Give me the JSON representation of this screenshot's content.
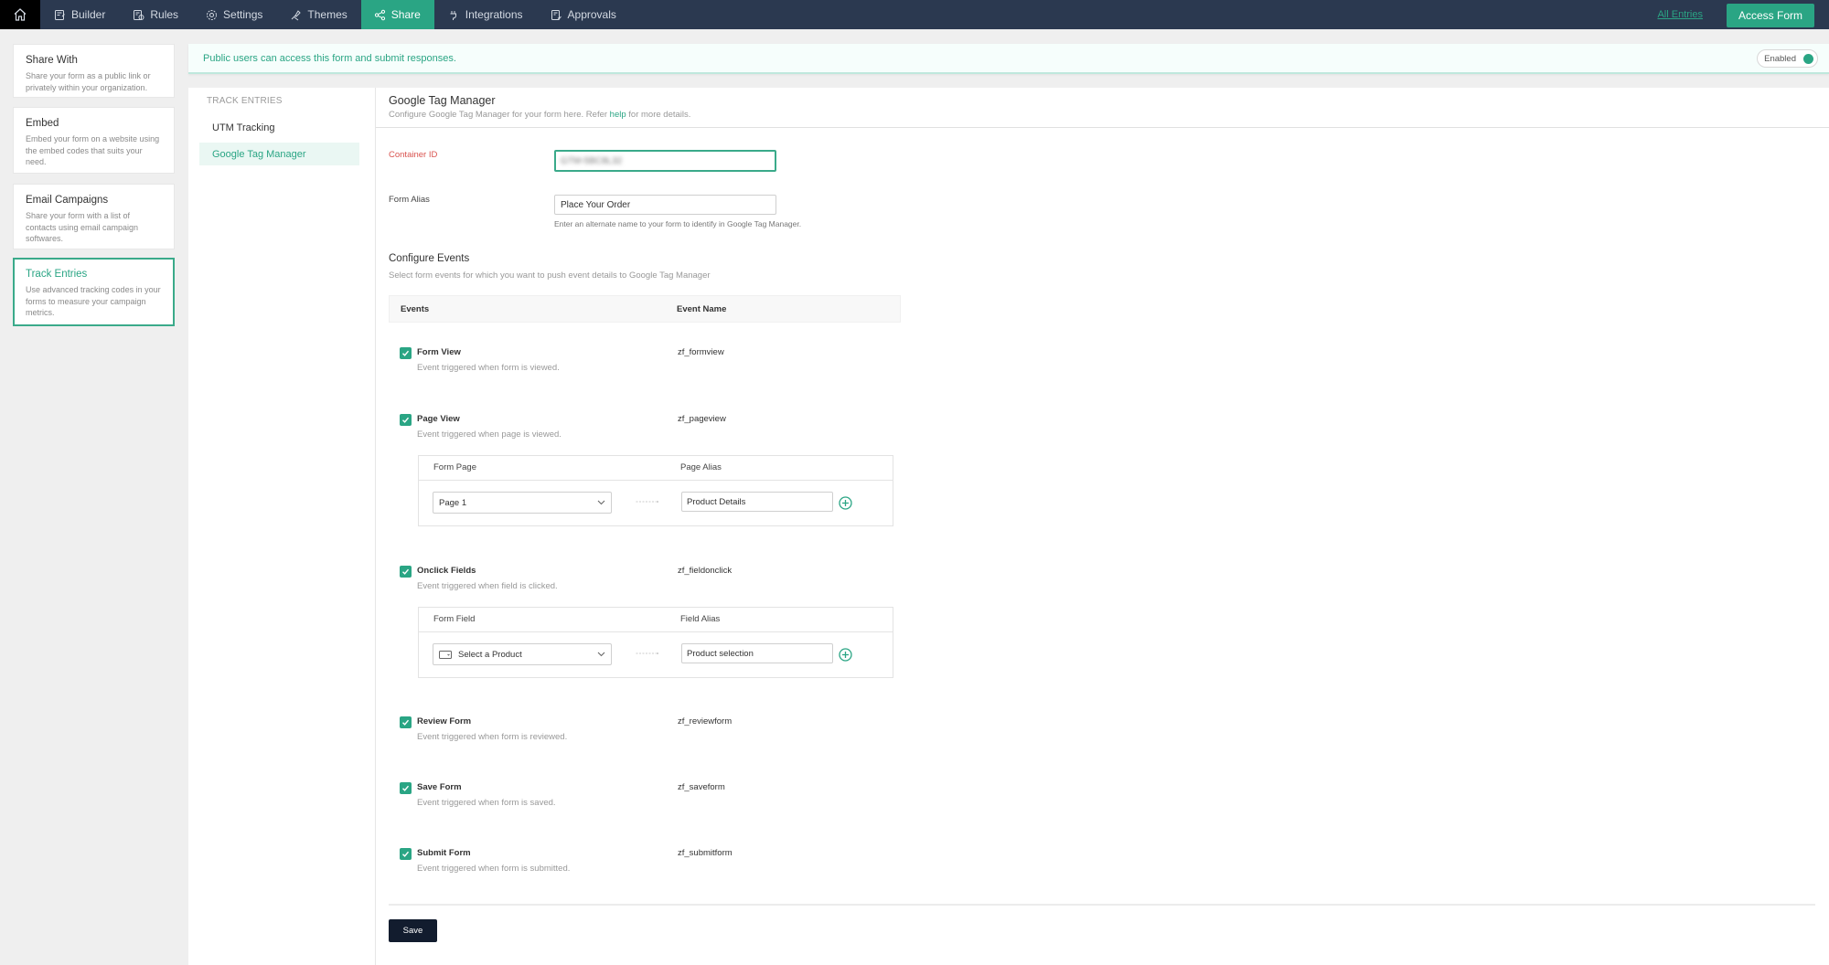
{
  "topnav": {
    "items": [
      {
        "label": "Builder",
        "icon": "builder-icon"
      },
      {
        "label": "Rules",
        "icon": "rules-icon"
      },
      {
        "label": "Settings",
        "icon": "gear-icon"
      },
      {
        "label": "Themes",
        "icon": "themes-brush-icon"
      },
      {
        "label": "Share",
        "icon": "share-icon",
        "active": true
      },
      {
        "label": "Integrations",
        "icon": "integrations-plug-icon"
      },
      {
        "label": "Approvals",
        "icon": "approvals-icon"
      }
    ],
    "all_entries_label": "All Entries",
    "access_form_label": "Access Form"
  },
  "share_options": [
    {
      "title": "Share With",
      "desc": "Share your form as a public link or privately within your organization."
    },
    {
      "title": "Embed",
      "desc": "Embed your form on a website using the embed codes that suits your need."
    },
    {
      "title": "Email Campaigns",
      "desc": "Share your form with a list of contacts using email campaign softwares."
    },
    {
      "title": "Track Entries",
      "desc": "Use advanced tracking codes in your forms to measure your campaign metrics.",
      "active": true
    }
  ],
  "banner": {
    "text": "Public users can access this form and submit responses.",
    "toggle_label": "Enabled",
    "toggle_on": true
  },
  "subnav": {
    "heading": "TRACK ENTRIES",
    "items": [
      {
        "label": "UTM Tracking"
      },
      {
        "label": "Google Tag Manager",
        "active": true
      }
    ]
  },
  "gtm": {
    "title": "Google Tag Manager",
    "subtitle_pre": "Configure Google Tag Manager for your form here. Refer ",
    "subtitle_link": "help",
    "subtitle_post": " for more details.",
    "container_id_label": "Container ID",
    "container_id_value": "GTM-5BC8L32",
    "form_alias_label": "Form Alias",
    "form_alias_value": "Place Your Order",
    "form_alias_hint": "Enter an alternate name to your form to identify in Google Tag Manager.",
    "configure_title": "Configure Events",
    "configure_sub": "Select form events for which you want to push event details to Google Tag Manager",
    "col_events": "Events",
    "col_event_name": "Event Name",
    "events": [
      {
        "name": "Form View",
        "desc": "Event triggered when form is viewed.",
        "code": "zf_formview",
        "checked": true
      },
      {
        "name": "Page View",
        "desc": "Event triggered when page is viewed.",
        "code": "zf_pageview",
        "checked": true,
        "mapping": {
          "col1": "Form Page",
          "col2": "Page Alias",
          "select_value": "Page 1",
          "alias_value": "Product Details"
        }
      },
      {
        "name": "Onclick Fields",
        "desc": "Event triggered when field is clicked.",
        "code": "zf_fieldonclick",
        "checked": true,
        "mapping": {
          "col1": "Form Field",
          "col2": "Field Alias",
          "select_value": "Select a Product",
          "alias_value": "Product selection"
        }
      },
      {
        "name": "Review Form",
        "desc": "Event triggered when form is reviewed.",
        "code": "zf_reviewform",
        "checked": true
      },
      {
        "name": "Save Form",
        "desc": "Event triggered when form is saved.",
        "code": "zf_saveform",
        "checked": true
      },
      {
        "name": "Submit Form",
        "desc": "Event triggered when form is submitted.",
        "code": "zf_submitform",
        "checked": true
      }
    ],
    "save_label": "Save"
  },
  "colors": {
    "accent": "#2aa584",
    "nav_bg": "#2b3950",
    "required": "#d9534f",
    "save_bg": "#121c2e"
  }
}
